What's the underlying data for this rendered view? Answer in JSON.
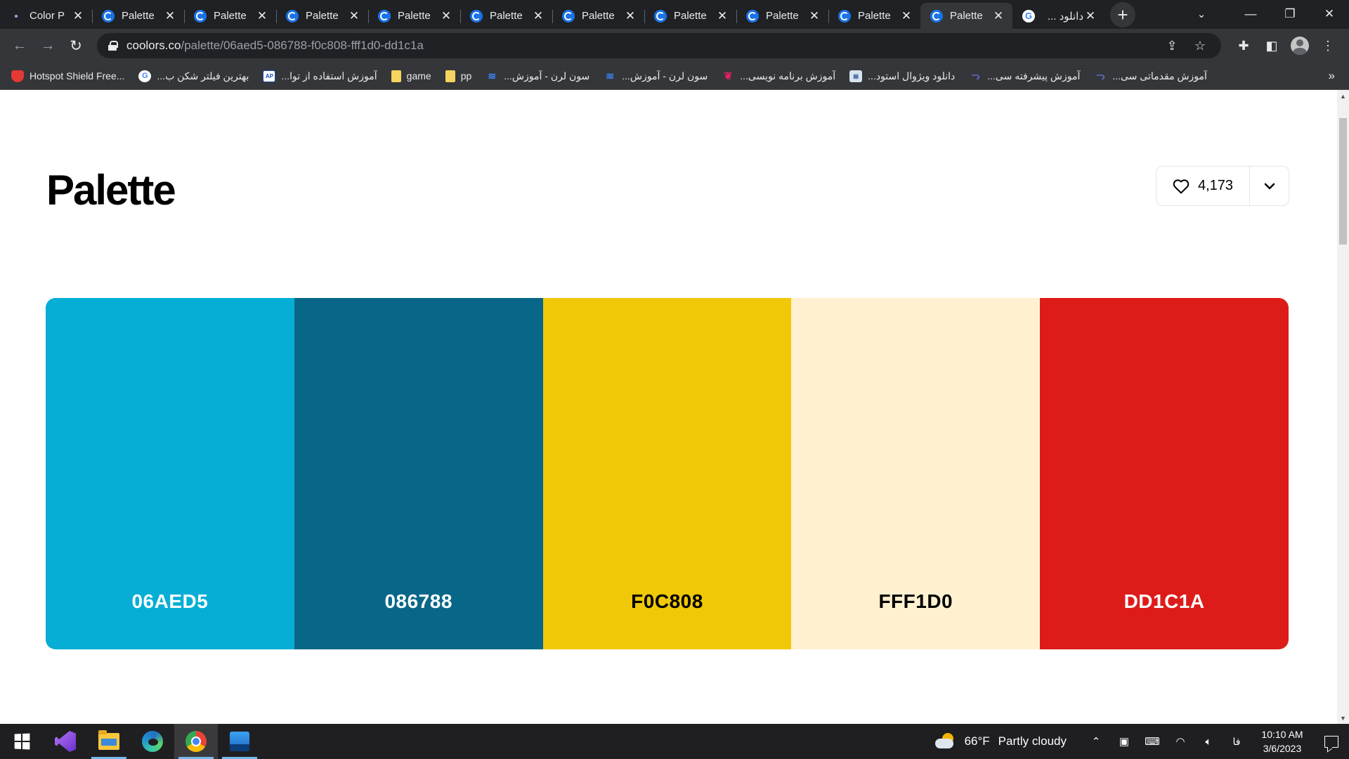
{
  "browser": {
    "tabs": [
      {
        "title": "Color P",
        "icon": "dot",
        "active": false
      },
      {
        "title": "Palette",
        "icon": "coolors",
        "active": false
      },
      {
        "title": "Palette",
        "icon": "coolors",
        "active": false
      },
      {
        "title": "Palette",
        "icon": "coolors",
        "active": false
      },
      {
        "title": "Palette",
        "icon": "coolors",
        "active": false
      },
      {
        "title": "Palette",
        "icon": "coolors",
        "active": false
      },
      {
        "title": "Palette",
        "icon": "coolors",
        "active": false
      },
      {
        "title": "Palette",
        "icon": "coolors",
        "active": false
      },
      {
        "title": "Palette",
        "icon": "coolors",
        "active": false
      },
      {
        "title": "Palette",
        "icon": "coolors",
        "active": false
      },
      {
        "title": "Palette",
        "icon": "coolors",
        "active": true
      },
      {
        "title": "دانلود ...",
        "icon": "google",
        "active": false
      }
    ],
    "tab_close_glyph": "✕",
    "new_tab_glyph": "+",
    "url_host": "coolors.co",
    "url_path": "/palette/06aed5-086788-f0c808-fff1d0-dd1c1a",
    "bookmarks": [
      {
        "label": "Hotspot Shield Free...",
        "icon": "hotspot",
        "rtl": false
      },
      {
        "label": "بهترین فیلتر شکن ب...",
        "icon": "google",
        "rtl": true
      },
      {
        "label": "آموزش استفاده از توا...",
        "icon": "ap",
        "rtl": true
      },
      {
        "label": "game",
        "icon": "folder",
        "rtl": false
      },
      {
        "label": "pp",
        "icon": "folder",
        "rtl": false
      },
      {
        "label": "سون لرن - آموزش...",
        "icon": "sevenlearn",
        "rtl": true
      },
      {
        "label": "سون لرن - آموزش...",
        "icon": "sevenlearn",
        "rtl": true
      },
      {
        "label": "آموزش برنامه نویسی...",
        "icon": "code",
        "rtl": true
      },
      {
        "label": "دانلود ویژوال استود...",
        "icon": "vs",
        "rtl": true
      },
      {
        "label": "آموزش پیشرفته سی...",
        "icon": "dl",
        "rtl": true
      },
      {
        "label": "آموزش مقدماتی سی...",
        "icon": "dl",
        "rtl": true
      }
    ],
    "bookmarks_more": "»"
  },
  "page": {
    "title": "Palette",
    "likes": "4,173",
    "swatches": [
      {
        "hex": "06AED5",
        "color": "#06aed5",
        "text_color": "#ffffff"
      },
      {
        "hex": "086788",
        "color": "#086788",
        "text_color": "#ffffff"
      },
      {
        "hex": "F0C808",
        "color": "#f0c808",
        "text_color": "#000000"
      },
      {
        "hex": "FFF1D0",
        "color": "#fff1d0",
        "text_color": "#000000"
      },
      {
        "hex": "DD1C1A",
        "color": "#dd1c1a",
        "text_color": "#ffffff"
      }
    ]
  },
  "taskbar": {
    "apps": [
      "start-icon",
      "visual-studio-icon",
      "file-explorer-icon",
      "edge-icon",
      "chrome-icon",
      "photos-icon"
    ],
    "weather_temp": "66°F",
    "weather_text": "Partly cloudy",
    "language": "فا",
    "time": "10:10 AM",
    "date": "3/6/2023"
  }
}
